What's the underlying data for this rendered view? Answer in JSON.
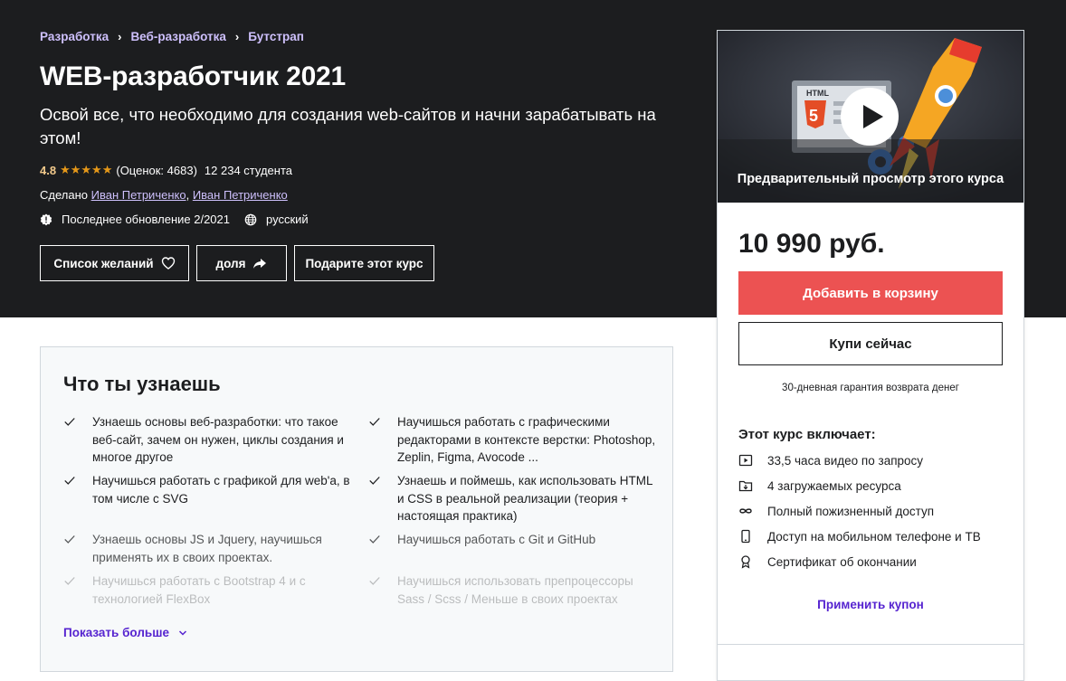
{
  "breadcrumb": [
    {
      "label": "Разработка"
    },
    {
      "label": "Веб-разработка"
    },
    {
      "label": "Бутстрап"
    }
  ],
  "course": {
    "title": "WEB-разработчик 2021",
    "subtitle": "Освой все, что необходимо для создания web-сайтов и начни зарабатывать на этом!",
    "rating": "4.8",
    "stars": "★★★★★",
    "rating_count": "(Оценок: 4683)",
    "students": "12 234 студента",
    "created_by": "Сделано",
    "authors": [
      "Иван Петриченко",
      "Иван Петриченко"
    ],
    "author_sep": ",",
    "last_update": "Последнее обновление 2/2021",
    "language": "русский"
  },
  "actions": {
    "wishlist": "Список желаний",
    "share": "доля",
    "gift": "Подарите этот курс"
  },
  "learn": {
    "title": "Что ты узнаешь",
    "items": [
      "Узнаешь основы веб-разработки: что такое веб-сайт, зачем он нужен, циклы создания и многое другое",
      "Научишься работать с графическими редакторами в контексте верстки: Photoshop, Zeplin, Figma, Avocode ...",
      "Научишься работать с графикой для web'a, в том числе с SVG",
      "Узнаешь и поймешь, как использовать HTML и CSS в реальной реализации (теория + настоящая практика)",
      "Узнаешь основы JS и Jquery, научишься применять их в своих проектах.",
      "Научишься работать с Git и GitHub",
      "Научишься работать с Bootstrap 4 и с технологией FlexBox",
      "Научишься использовать препроцессоры Sass / Scss / Меньше в своих проектах"
    ],
    "show_more": "Показать больше"
  },
  "sidebar": {
    "preview_caption": "Предварительный просмотр этого курса",
    "preview_html_label": "HTML",
    "price": "10 990 руб.",
    "add_to_cart": "Добавить в корзину",
    "buy_now": "Купи сейчас",
    "guarantee": "30-дневная гарантия возврата денег",
    "includes_title": "Этот курс включает:",
    "includes": [
      {
        "icon": "video-icon",
        "label": "33,5 часа видео по запросу"
      },
      {
        "icon": "download-folder-icon",
        "label": "4 загружаемых ресурса"
      },
      {
        "icon": "infinity-icon",
        "label": "Полный пожизненный доступ"
      },
      {
        "icon": "mobile-icon",
        "label": "Доступ на мобильном телефоне и ТВ"
      },
      {
        "icon": "certificate-icon",
        "label": "Сертификат об окончании"
      }
    ],
    "apply_coupon": "Применить купон"
  },
  "colors": {
    "hero_bg": "#1c1d1f",
    "link_purple": "#cec0fc",
    "star_gold": "#e59819",
    "cart_red": "#ec5252",
    "accent_purple": "#5624d0"
  }
}
